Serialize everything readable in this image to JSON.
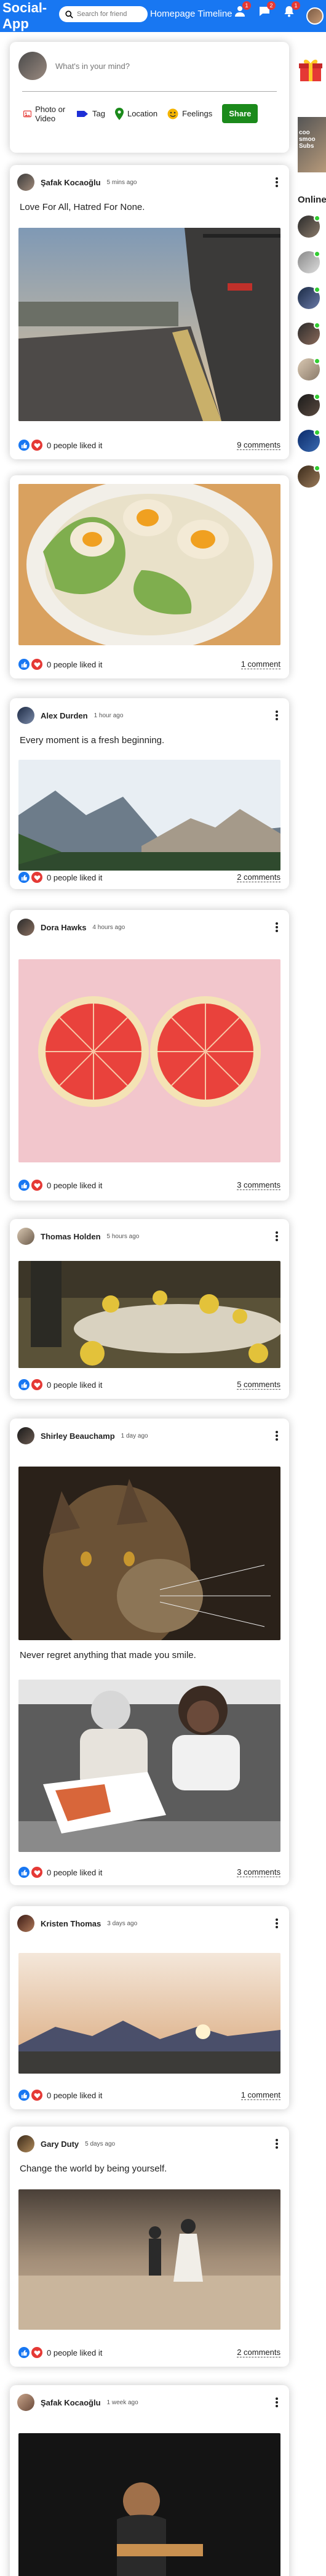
{
  "app": {
    "logo": "Social-App"
  },
  "topbar": {
    "search_placeholder": "Search for friend",
    "links": [
      "Homepage",
      "Timeline"
    ],
    "badges": {
      "friends": "1",
      "messages": "2",
      "notifications": "1"
    }
  },
  "share": {
    "placeholder": "What's in your mind?",
    "options": {
      "media": "Photo or Video",
      "tag": "Tag",
      "location": "Location",
      "feelings": "Feelings"
    },
    "share_label": "Share"
  },
  "posts": [
    {
      "name": "Şafak Kocaoğlu",
      "time": "5 mins ago",
      "text": "Love For All, Hatred For None.",
      "image": "train-station",
      "likes": "0 people liked it",
      "comments": "9 comments"
    },
    {
      "name": "",
      "time": "",
      "text": "",
      "image": "ramen-bowl",
      "likes": "0 people liked it",
      "comments": "1 comment"
    },
    {
      "name": "Alex Durden",
      "time": "1 hour ago",
      "text": "Every moment is a fresh beginning.",
      "image": "mountains",
      "likes": "0 people liked it",
      "comments": "2 comments"
    },
    {
      "name": "Dora Hawks",
      "time": "4 hours ago",
      "text": "",
      "image": "grapefruit",
      "likes": "0 people liked it",
      "comments": "3 comments"
    },
    {
      "name": "Thomas Holden",
      "time": "5 hours ago",
      "text": "",
      "image": "dining-table",
      "likes": "0 people liked it",
      "comments": "5 comments"
    },
    {
      "name": "Shirley Beauchamp",
      "time": "1 day ago",
      "text": "Never regret anything that made you smile.",
      "image": "cat-and-kids",
      "likes": "0 people liked it",
      "comments": "3 comments"
    },
    {
      "name": "Kristen Thomas",
      "time": "3 days ago",
      "text": "",
      "image": "sunset-mountains",
      "likes": "0 people liked it",
      "comments": "1 comment"
    },
    {
      "name": "Gary Duty",
      "time": "5 days ago",
      "text": "Change the world by being yourself.",
      "image": "couple-desert",
      "likes": "0 people liked it",
      "comments": "2 comments"
    },
    {
      "name": "Şafak Kocaoğlu",
      "time": "1 week ago",
      "text": "",
      "image": "dark-portrait",
      "likes": "",
      "comments": ""
    }
  ],
  "sidebar": {
    "ad_text": "coo smoo Subs",
    "online_title": "Online"
  },
  "colors": {
    "brand": "#1877f2",
    "share_button": "#1b8a1b",
    "online": "#32cd32",
    "heart": "#e53935"
  }
}
